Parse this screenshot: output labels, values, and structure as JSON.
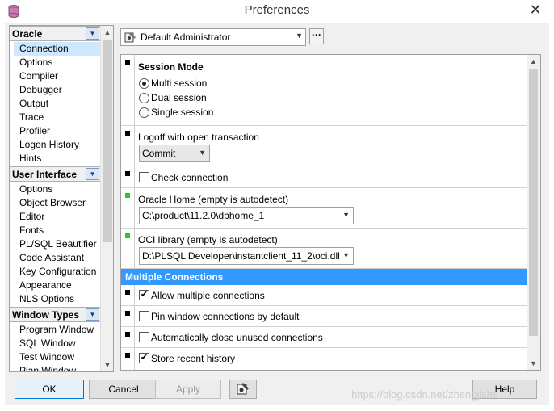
{
  "window": {
    "title": "Preferences",
    "close_symbol": "✕"
  },
  "nav": {
    "groups": [
      {
        "label": "Oracle",
        "items": [
          "Connection",
          "Options",
          "Compiler",
          "Debugger",
          "Output",
          "Trace",
          "Profiler",
          "Logon History",
          "Hints"
        ]
      },
      {
        "label": "User Interface",
        "items": [
          "Options",
          "Object Browser",
          "Editor",
          "Fonts",
          "PL/SQL Beautifier",
          "Code Assistant",
          "Key Configuration",
          "Appearance",
          "NLS Options"
        ]
      },
      {
        "label": "Window Types",
        "items": [
          "Program Window",
          "SQL Window",
          "Test Window",
          "Plan Window"
        ]
      }
    ],
    "selected": "Connection"
  },
  "profile": {
    "value": "Default Administrator",
    "more_label": "···"
  },
  "settings": {
    "session_mode": {
      "label": "Session Mode",
      "options": [
        "Multi session",
        "Dual session",
        "Single session"
      ],
      "selected": "Multi session"
    },
    "logoff": {
      "label": "Logoff with open transaction",
      "value": "Commit"
    },
    "check_connection": {
      "label": "Check connection",
      "checked": false
    },
    "oracle_home": {
      "label": "Oracle Home (empty is autodetect)",
      "value": "C:\\product\\11.2.0\\dbhome_1"
    },
    "oci_library": {
      "label": "OCI library (empty is autodetect)",
      "value": "D:\\PLSQL Developer\\instantclient_11_2\\oci.dll"
    },
    "multiple_connections_header": "Multiple Connections",
    "allow_multiple": {
      "label": "Allow multiple connections",
      "checked": true
    },
    "pin_window": {
      "label": "Pin window connections by default",
      "checked": false
    },
    "auto_close": {
      "label": "Automatically close unused connections",
      "checked": false
    },
    "store_recent": {
      "label": "Store recent history",
      "checked": true
    }
  },
  "buttons": {
    "ok": "OK",
    "cancel": "Cancel",
    "apply": "Apply",
    "help": "Help"
  },
  "watermark": "https://blog.csdn.net/zhengjishe"
}
